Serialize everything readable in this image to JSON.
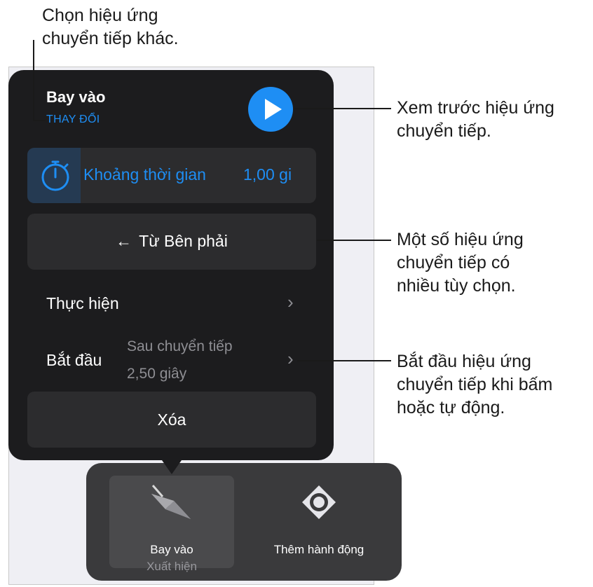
{
  "popover": {
    "title": "Bay vào",
    "change_label": "THAY ĐỔI",
    "duration_label": "Khoảng thời gian",
    "duration_value": "1,00 gi",
    "direction_label": "Từ Bên phải",
    "direction_arrow": "←",
    "perform_label": "Thực hiện",
    "start_label": "Bắt đầu",
    "start_value_line1": "Sau chuyển tiếp",
    "start_value_line2": "2,50 giây",
    "chevron": "›",
    "delete_label": "Xóa"
  },
  "bottom_bar": {
    "items": [
      {
        "label": "Bay vào",
        "sublabel": "Xuất hiện",
        "icon": "paper-plane-icon"
      },
      {
        "label": "Thêm hành động",
        "icon": "action-target-icon"
      }
    ]
  },
  "callouts": {
    "change": [
      "Chọn hiệu ứng",
      "chuyển tiếp khác."
    ],
    "preview": [
      "Xem trước hiệu ứng",
      "chuyển tiếp."
    ],
    "options": [
      "Một số hiệu ứng",
      "chuyển tiếp có",
      "nhiều tùy chọn."
    ],
    "start": [
      "Bắt đầu hiệu ứng",
      "chuyển tiếp khi bấm",
      "hoặc tự động."
    ]
  },
  "colors": {
    "accent": "#1e8ef4",
    "popover_bg": "#1c1c1e",
    "row_bg": "#2c2c2e",
    "secondary_text": "#8e8e93"
  }
}
